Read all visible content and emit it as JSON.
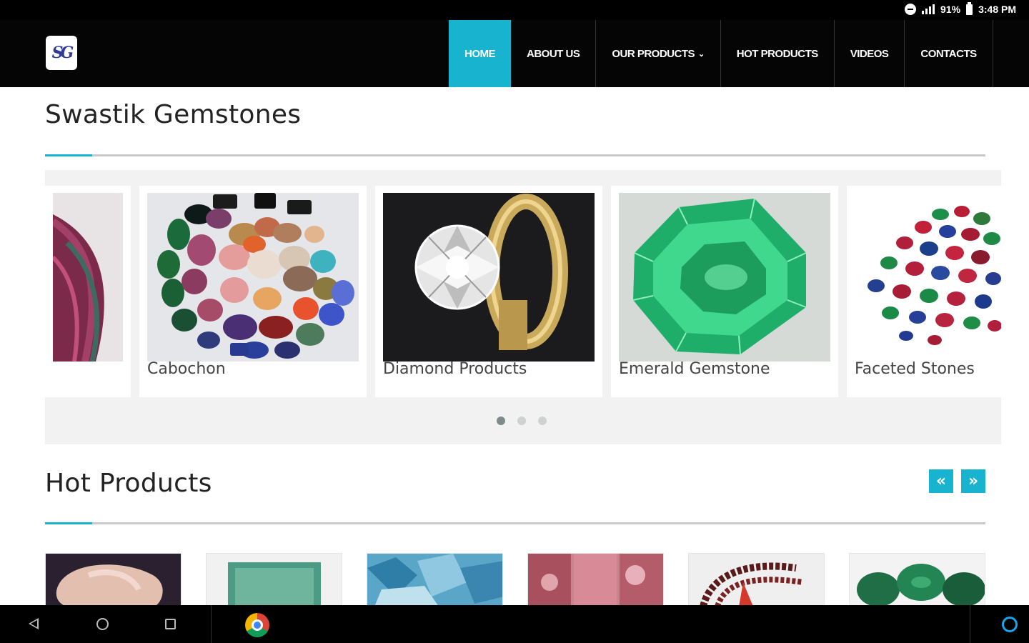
{
  "status_bar": {
    "battery": "91%",
    "time": "3:48 PM"
  },
  "header": {
    "logo_text": "SG",
    "nav": [
      {
        "label": "HOME",
        "active": true
      },
      {
        "label": "ABOUT US",
        "active": false
      },
      {
        "label": "OUR PRODUCTS",
        "active": false,
        "dropdown": true
      },
      {
        "label": "HOT PRODUCTS",
        "active": false
      },
      {
        "label": "VIDEOS",
        "active": false
      },
      {
        "label": "CONTACTS",
        "active": false
      }
    ]
  },
  "main": {
    "title": "Swastik Gemstones",
    "carousel": {
      "cards": [
        {
          "label": ""
        },
        {
          "label": "Cabochon"
        },
        {
          "label": "Diamond Products"
        },
        {
          "label": "Emerald Gemstone"
        },
        {
          "label": "Faceted Stones"
        }
      ],
      "page_count": 3,
      "active_page": 1
    }
  },
  "hot_products": {
    "title": "Hot Products",
    "prev_icon": "«",
    "next_icon": "»",
    "items": [
      "rough-quartz",
      "emerald-slab",
      "larimar-rough",
      "pink-tourmaline",
      "garnet-beads",
      "malachite-rough"
    ]
  },
  "colors": {
    "accent": "#17b3cf",
    "header_bg": "#050505"
  }
}
